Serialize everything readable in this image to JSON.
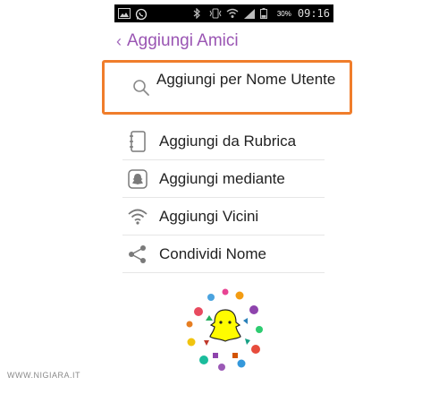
{
  "status_bar": {
    "battery_percent": "30%",
    "time": "09:16",
    "left_icons": [
      "image-icon",
      "whatsapp-icon"
    ],
    "right_icons": [
      "bluetooth-icon",
      "vibrate-icon",
      "wifi-icon",
      "signal-icon",
      "battery-icon"
    ]
  },
  "header": {
    "back_label": "‹",
    "title": "Aggiungi Amici"
  },
  "menu": {
    "search_by_username": "Aggiungi per Nome Utente",
    "from_contacts": "Aggiungi da Rubrica",
    "via_snapcode": "Aggiungi mediante",
    "nearby": "Aggiungi Vicini",
    "share_username": "Condividi Nome"
  },
  "watermark": "WWW.NIGIARA.IT",
  "colors": {
    "accent_purple": "#9a55b3",
    "highlight_orange": "#f07d2b",
    "icon_gray": "#7a7a7a",
    "divider": "#e6e6e6"
  }
}
